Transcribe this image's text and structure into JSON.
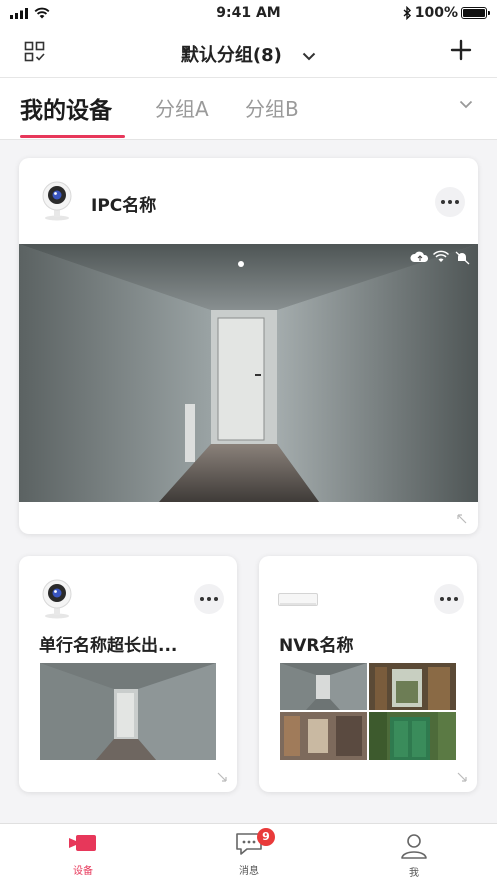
{
  "status_bar": {
    "time": "9:41 AM",
    "battery": "100%"
  },
  "nav": {
    "title": "默认分组(8)"
  },
  "tabs": [
    {
      "label": "我的设备",
      "active": true
    },
    {
      "label": "分组A",
      "active": false
    },
    {
      "label": "分组B",
      "active": false
    }
  ],
  "devices": {
    "ipc_main": {
      "name": "IPC名称"
    },
    "ipc_small": {
      "name": "单行名称超长出..."
    },
    "nvr": {
      "name": "NVR名称"
    }
  },
  "tabbar": {
    "devices": "设备",
    "messages": "消息",
    "messages_badge": "9",
    "me": "我"
  },
  "colors": {
    "accent": "#e7375a",
    "badge": "#e93a3a"
  }
}
